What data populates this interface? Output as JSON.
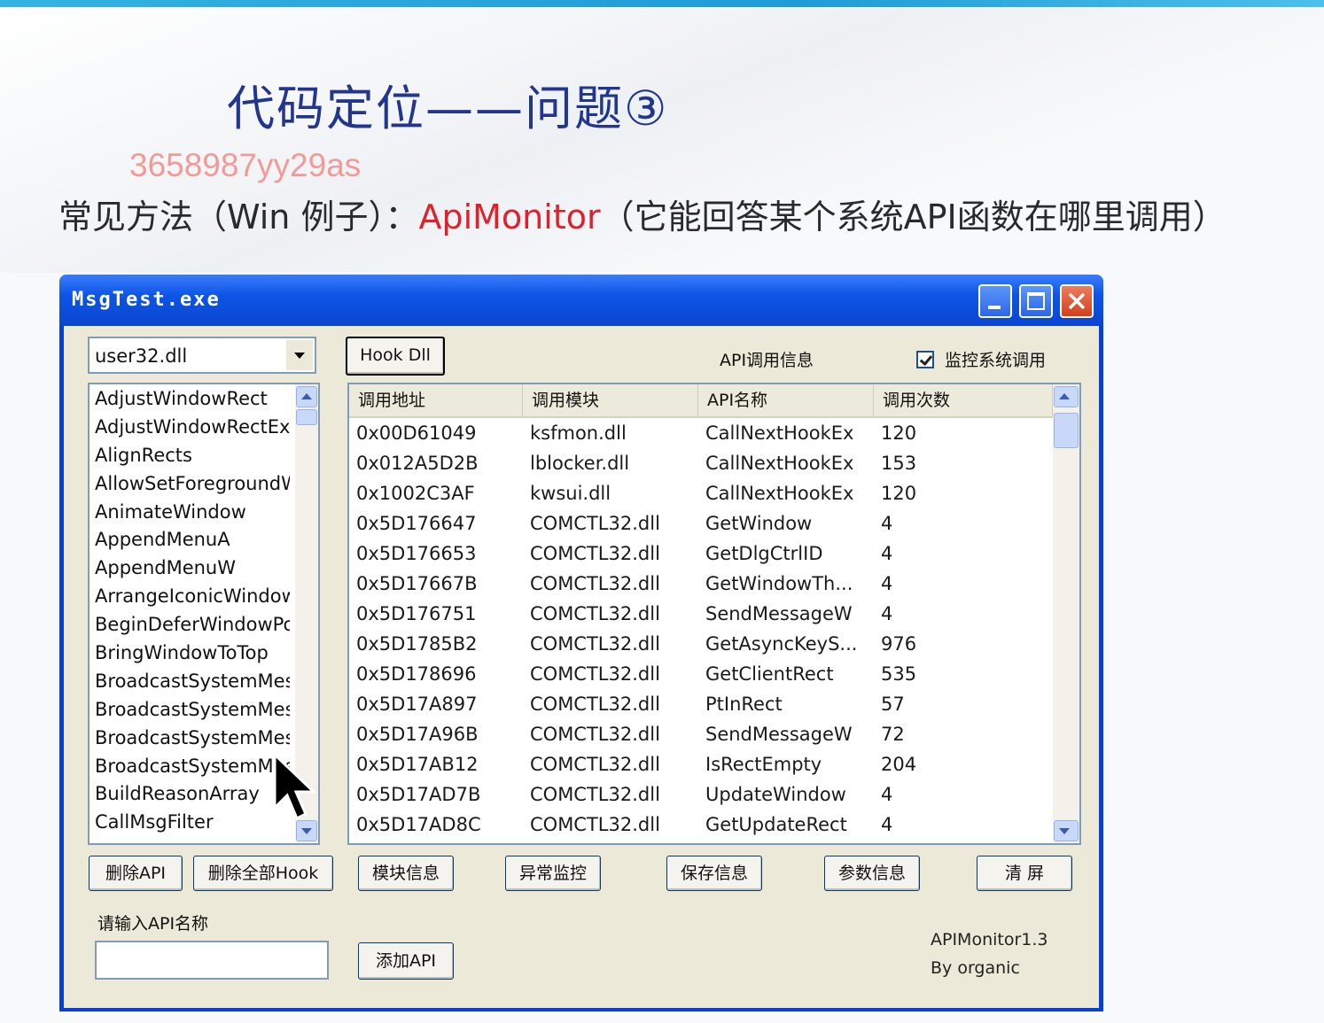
{
  "slide": {
    "title": "代码定位——问题③",
    "watermark": "3658987yy29as",
    "subtitle_prefix": "常见方法（Win 例子）：",
    "subtitle_highlight": "ApiMonitor",
    "subtitle_suffix": "（它能回答某个系统API函数在哪里调用）"
  },
  "window": {
    "title": "MsgTest.exe",
    "dll_select": "user32.dll",
    "hook_button": "Hook Dll",
    "api_call_info_label": "API调用信息",
    "monitor_checkbox_label": "监控系统调用",
    "monitor_checked": true,
    "api_list": [
      "AdjustWindowRect",
      "AdjustWindowRectEx",
      "AlignRects",
      "AllowSetForegroundWindow",
      "AnimateWindow",
      "AppendMenuA",
      "AppendMenuW",
      "ArrangeIconicWindows",
      "BeginDeferWindowPos",
      "BringWindowToTop",
      "BroadcastSystemMessage",
      "BroadcastSystemMessageA",
      "BroadcastSystemMessageEx",
      "BroadcastSystemMessageW",
      "BuildReasonArray",
      "CallMsgFilter"
    ],
    "table": {
      "columns": [
        "调用地址",
        "调用模块",
        "API名称",
        "调用次数"
      ],
      "rows": [
        [
          "0x00D61049",
          "ksfmon.dll",
          "CallNextHookEx",
          "120"
        ],
        [
          "0x012A5D2B",
          "lblocker.dll",
          "CallNextHookEx",
          "153"
        ],
        [
          "0x1002C3AF",
          "kwsui.dll",
          "CallNextHookEx",
          "120"
        ],
        [
          "0x5D176647",
          "COMCTL32.dll",
          "GetWindow",
          "4"
        ],
        [
          "0x5D176653",
          "COMCTL32.dll",
          "GetDlgCtrlID",
          "4"
        ],
        [
          "0x5D17667B",
          "COMCTL32.dll",
          "GetWindowTh...",
          "4"
        ],
        [
          "0x5D176751",
          "COMCTL32.dll",
          "SendMessageW",
          "4"
        ],
        [
          "0x5D1785B2",
          "COMCTL32.dll",
          "GetAsyncKeyS...",
          "976"
        ],
        [
          "0x5D178696",
          "COMCTL32.dll",
          "GetClientRect",
          "535"
        ],
        [
          "0x5D17A897",
          "COMCTL32.dll",
          "PtInRect",
          "57"
        ],
        [
          "0x5D17A96B",
          "COMCTL32.dll",
          "SendMessageW",
          "72"
        ],
        [
          "0x5D17AB12",
          "COMCTL32.dll",
          "IsRectEmpty",
          "204"
        ],
        [
          "0x5D17AD7B",
          "COMCTL32.dll",
          "UpdateWindow",
          "4"
        ],
        [
          "0x5D17AD8C",
          "COMCTL32.dll",
          "GetUpdateRect",
          "4"
        ]
      ]
    },
    "buttons": {
      "delete_api": "删除API",
      "delete_all_hook": "删除全部Hook",
      "module_info": "模块信息",
      "exception_monitor": "异常监控",
      "save_info": "保存信息",
      "param_info": "参数信息",
      "clear_screen": "清 屏",
      "add_api": "添加API"
    },
    "input_label": "请输入API名称",
    "input_value": "",
    "version": "APIMonitor1.3",
    "author": "By organic"
  }
}
